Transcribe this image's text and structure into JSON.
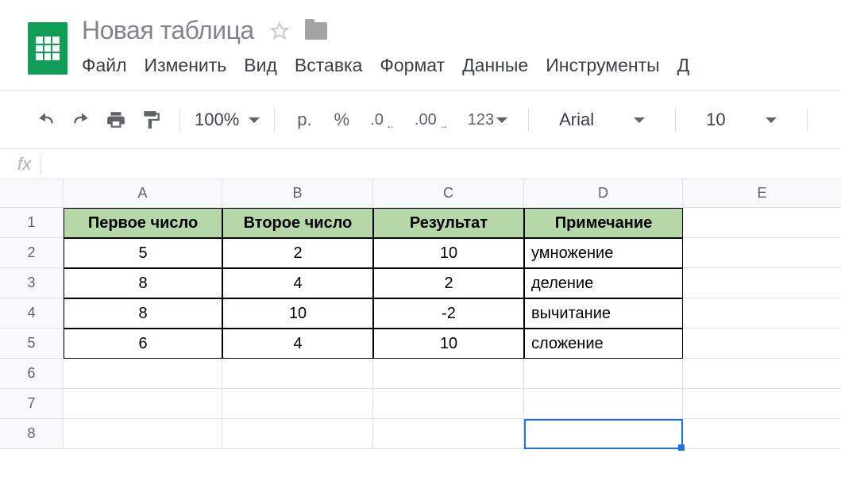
{
  "doc_title": "Новая таблица",
  "menu": {
    "file": "Файл",
    "edit": "Изменить",
    "view": "Вид",
    "insert": "Вставка",
    "format": "Формат",
    "data": "Данные",
    "tools": "Инструменты",
    "more": "Д"
  },
  "toolbar": {
    "zoom": "100%",
    "currency": "р.",
    "percent": "%",
    "dec_less": ".0",
    "dec_more": ".00",
    "num_fmt": "123",
    "font": "Arial",
    "font_size": "10"
  },
  "formula_bar": {
    "fx": "fx"
  },
  "columns": [
    "A",
    "B",
    "C",
    "D",
    "E"
  ],
  "rows": [
    "1",
    "2",
    "3",
    "4",
    "5",
    "6",
    "7",
    "8"
  ],
  "table": {
    "headers": [
      "Первое число",
      "Второе число",
      "Результат",
      "Примечание"
    ],
    "rows": [
      {
        "a": "5",
        "b": "2",
        "c": "10",
        "d": "умножение"
      },
      {
        "a": "8",
        "b": "4",
        "c": "2",
        "d": "деление"
      },
      {
        "a": "8",
        "b": "10",
        "c": "-2",
        "d": "вычитание"
      },
      {
        "a": "6",
        "b": "4",
        "c": "10",
        "d": "сложение"
      }
    ]
  },
  "selected_cell": "D8"
}
